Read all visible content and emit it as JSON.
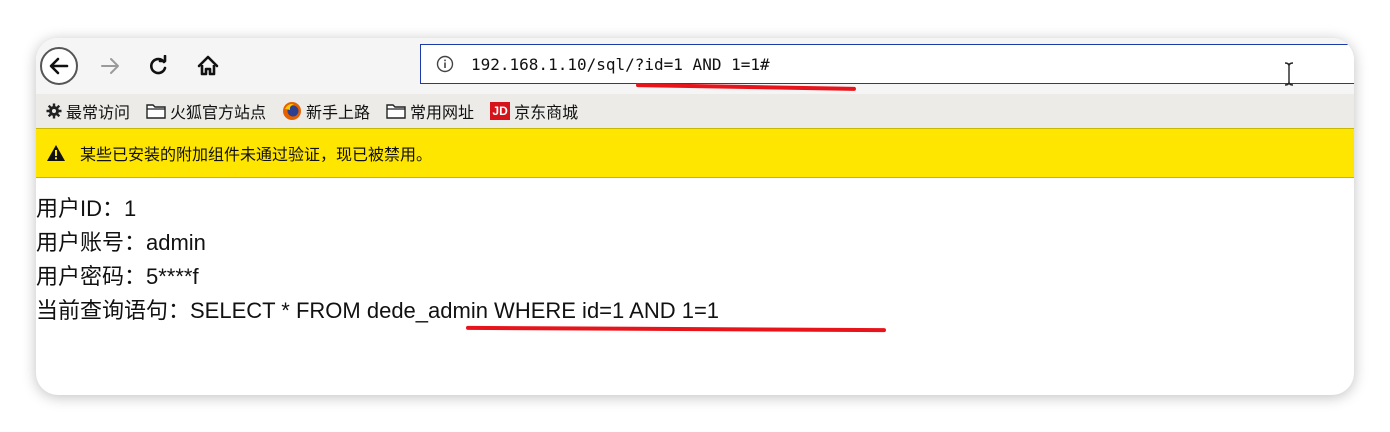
{
  "toolbar": {
    "back_icon": "arrow-left-icon",
    "forward_icon": "arrow-right-icon",
    "reload_icon": "reload-icon",
    "home_icon": "home-icon"
  },
  "address_bar": {
    "url": "192.168.1.10/sql/?id=1 AND 1=1#",
    "info_icon": "info-icon"
  },
  "bookmarks": [
    {
      "label": "最常访问",
      "icon": "gear-icon"
    },
    {
      "label": "火狐官方站点",
      "icon": "folder-icon"
    },
    {
      "label": "新手上路",
      "icon": "firefox-icon"
    },
    {
      "label": "常用网址",
      "icon": "folder-icon"
    },
    {
      "label": "京东商城",
      "icon": "jd-icon",
      "badge": "JD"
    }
  ],
  "warning": {
    "text": "某些已安装的附加组件未通过验证，现已被禁用。",
    "icon": "warning-icon"
  },
  "page": {
    "lines": [
      "用户ID：1",
      "用户账号：admin",
      "用户密码：5****f",
      "当前查询语句：SELECT * FROM dede_admin WHERE id=1 AND 1=1"
    ]
  },
  "colors": {
    "warning_bg": "#ffe600",
    "annotation_red": "#e8141b",
    "url_border": "#1d3aa8"
  }
}
